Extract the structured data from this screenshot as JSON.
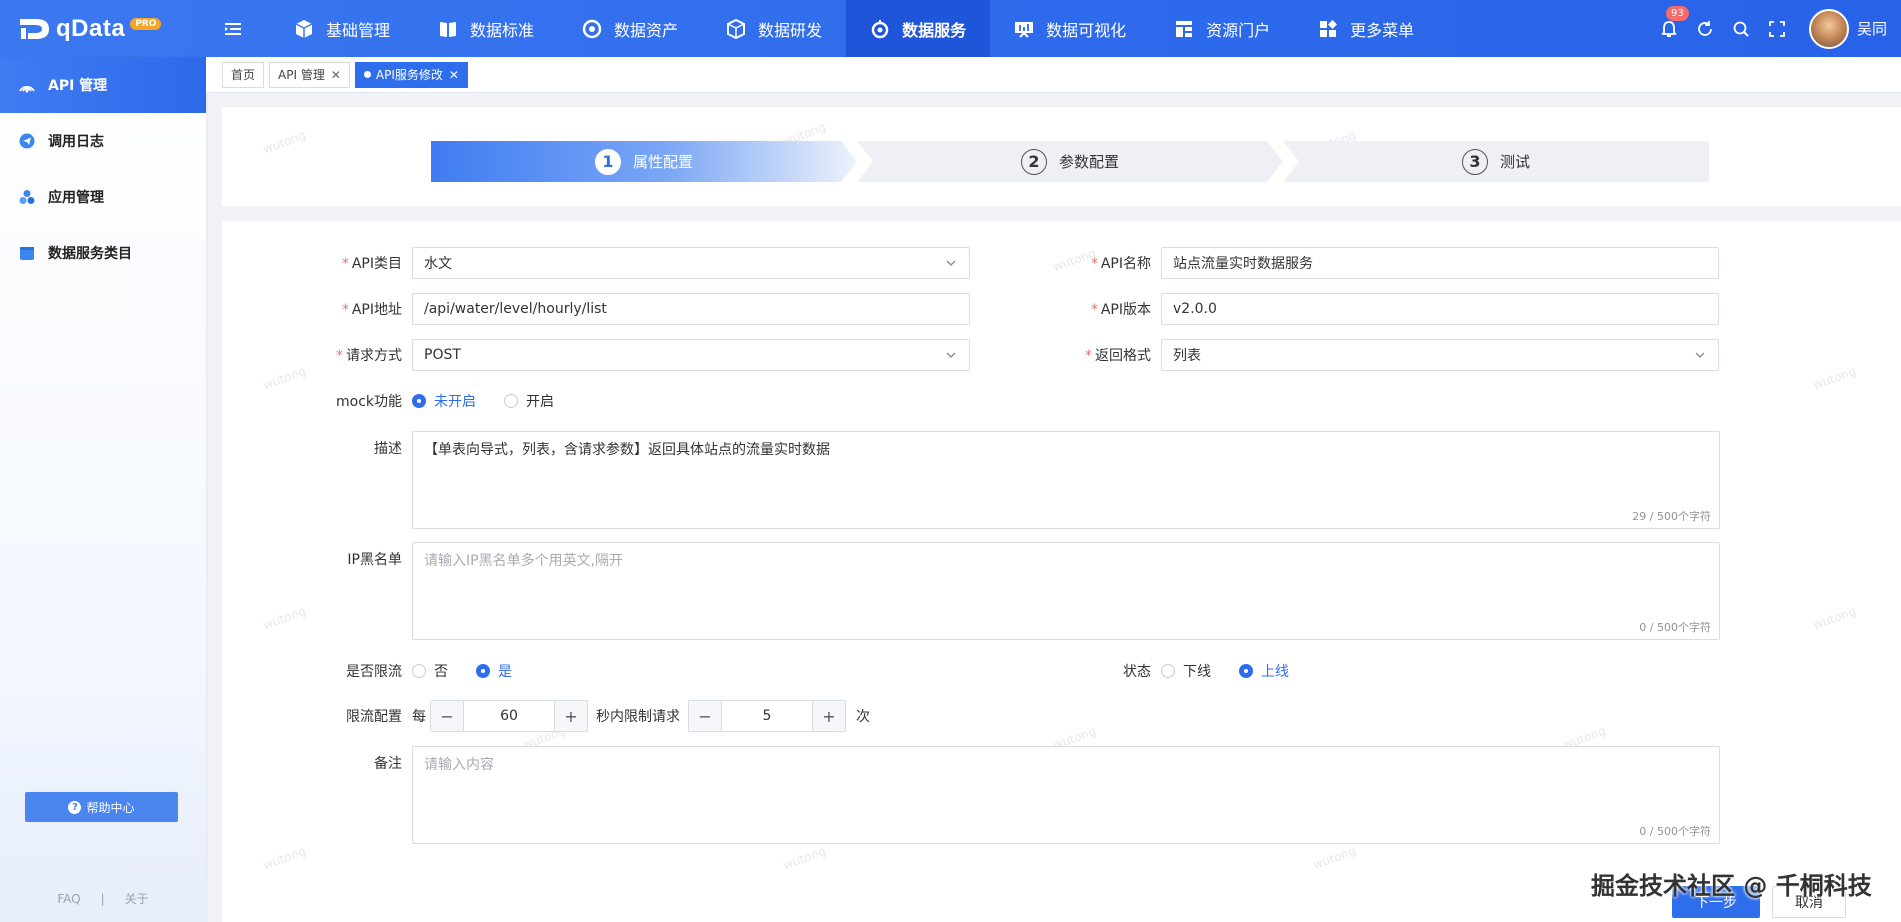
{
  "app": {
    "logo_text": "qData",
    "logo_badge": "PRO"
  },
  "nav": {
    "items": [
      {
        "label": "基础管理",
        "icon": "cube-icon"
      },
      {
        "label": "数据标准",
        "icon": "book-icon"
      },
      {
        "label": "数据资产",
        "icon": "target-icon"
      },
      {
        "label": "数据研发",
        "icon": "cube-code-icon"
      },
      {
        "label": "数据服务",
        "icon": "service-icon",
        "active": true
      },
      {
        "label": "数据可视化",
        "icon": "screen-icon"
      },
      {
        "label": "资源门户",
        "icon": "portal-icon"
      },
      {
        "label": "更多菜单",
        "icon": "grid-icon"
      }
    ],
    "notification_count": "93",
    "username": "吴同"
  },
  "sidebar": {
    "items": [
      {
        "label": "API 管理",
        "active": true
      },
      {
        "label": "调用日志"
      },
      {
        "label": "应用管理"
      },
      {
        "label": "数据服务类目"
      }
    ],
    "help_label": "帮助中心",
    "link_faq": "FAQ",
    "link_sep": "|",
    "link_about": "关于"
  },
  "tabs": [
    {
      "label": "首页"
    },
    {
      "label": "API 管理"
    },
    {
      "label": "API服务修改",
      "active": true
    }
  ],
  "steps": [
    {
      "num": "1",
      "label": "属性配置",
      "active": true
    },
    {
      "num": "2",
      "label": "参数配置"
    },
    {
      "num": "3",
      "label": "测试"
    }
  ],
  "form": {
    "api_category": {
      "label": "API类目",
      "value": "水文"
    },
    "api_name": {
      "label": "API名称",
      "value": "站点流量实时数据服务"
    },
    "api_path": {
      "label": "API地址",
      "value": "/api/water/level/hourly/list"
    },
    "api_version": {
      "label": "API版本",
      "value": "v2.0.0"
    },
    "request_method": {
      "label": "请求方式",
      "value": "POST"
    },
    "return_format": {
      "label": "返回格式",
      "value": "列表"
    },
    "mock": {
      "label": "mock功能",
      "options": [
        "未开启",
        "开启"
      ],
      "selected": "未开启"
    },
    "description": {
      "label": "描述",
      "value": "【单表向导式，列表，含请求参数】返回具体站点的流量实时数据",
      "count": "29 / 500个字符"
    },
    "ip_blacklist": {
      "label": "IP黑名单",
      "placeholder": "请输入IP黑名单多个用英文,隔开",
      "count": "0 / 500个字符"
    },
    "rate_limit": {
      "label": "是否限流",
      "options": [
        "否",
        "是"
      ],
      "selected": "是"
    },
    "status": {
      "label": "状态",
      "options": [
        "下线",
        "上线"
      ],
      "selected": "上线"
    },
    "rate_config": {
      "label": "限流配置",
      "prefix": "每",
      "seconds": "60",
      "middle": "秒内限制请求",
      "times": "5",
      "suffix": "次"
    },
    "remark": {
      "label": "备注",
      "placeholder": "请输入内容",
      "count": "0 / 500个字符"
    }
  },
  "actions": {
    "next": "下一步",
    "cancel": "取消"
  },
  "credit": "掘金技术社区 @ 千桐科技",
  "watermark": "wutong",
  "colors": {
    "primary": "#2e6eec",
    "required": "#f56c6c",
    "topbar": "#3b78f0"
  }
}
